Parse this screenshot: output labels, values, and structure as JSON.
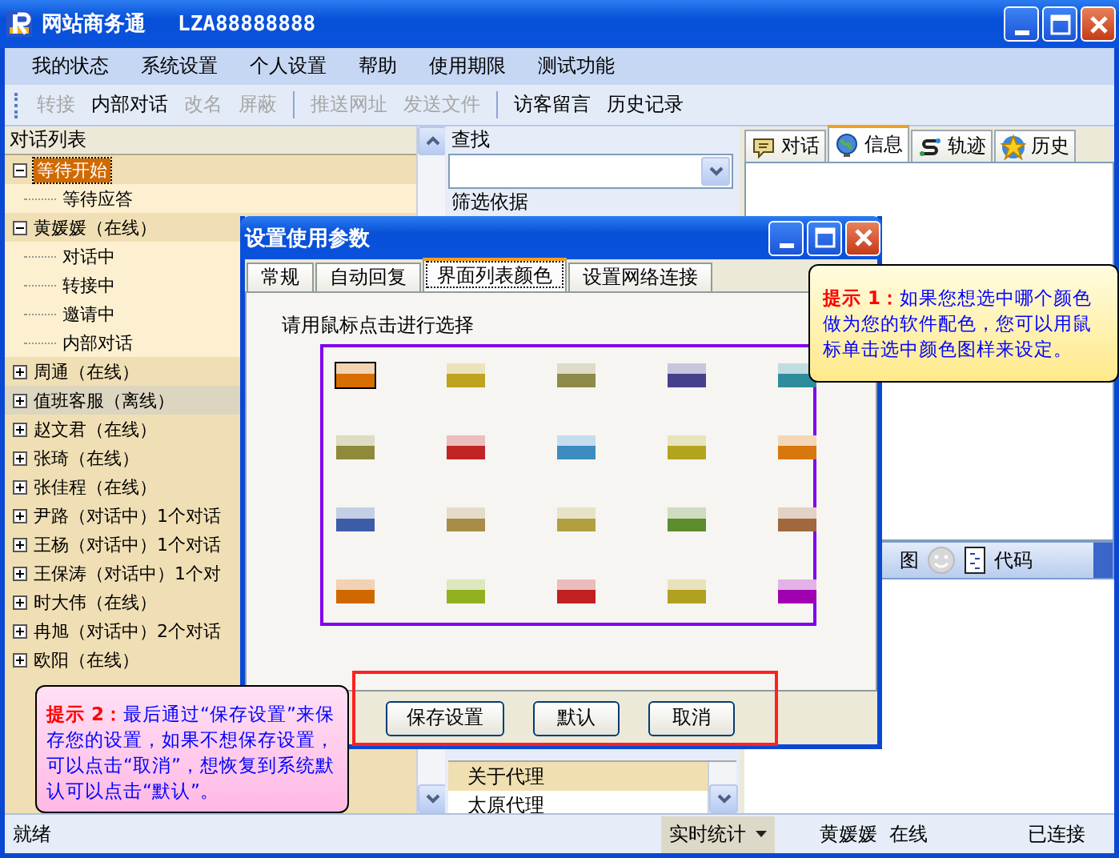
{
  "window": {
    "title": "网站商务通",
    "account": "LZA88888888"
  },
  "menu": [
    "我的状态",
    "系统设置",
    "个人设置",
    "帮助",
    "使用期限",
    "测试功能"
  ],
  "toolbar": [
    [
      {
        "label": "转接",
        "disabled": true
      },
      {
        "label": "内部对话",
        "disabled": false
      },
      {
        "label": "改名",
        "disabled": true
      },
      {
        "label": "屏蔽",
        "disabled": true
      }
    ],
    [
      {
        "label": "推送网址",
        "disabled": true
      },
      {
        "label": "发送文件",
        "disabled": true
      }
    ],
    [
      {
        "label": "访客留言",
        "disabled": false
      },
      {
        "label": "历史记录",
        "disabled": false
      }
    ]
  ],
  "chat_list": {
    "header": "对话列表",
    "items": [
      {
        "label": "等待开始",
        "expanded": true,
        "selected": true,
        "offline": false,
        "children": [
          {
            "label": "等待应答"
          }
        ]
      },
      {
        "label": "黄媛媛（在线）",
        "expanded": true,
        "selected": false,
        "offline": false,
        "children": [
          {
            "label": "对话中"
          },
          {
            "label": "转接中"
          },
          {
            "label": "邀请中"
          },
          {
            "label": "内部对话"
          }
        ]
      },
      {
        "label": "周通（在线）",
        "expanded": false,
        "selected": false,
        "offline": false
      },
      {
        "label": "值班客服（离线）",
        "expanded": false,
        "selected": false,
        "offline": true
      },
      {
        "label": "赵文君（在线）",
        "expanded": false,
        "selected": false,
        "offline": false
      },
      {
        "label": "张琦（在线）",
        "expanded": false,
        "selected": false,
        "offline": false
      },
      {
        "label": "张佳程（在线）",
        "expanded": false,
        "selected": false,
        "offline": false
      },
      {
        "label": "尹路（对话中）1个对话",
        "expanded": false,
        "selected": false,
        "offline": false
      },
      {
        "label": "王杨（对话中）1个对话",
        "expanded": false,
        "selected": false,
        "offline": false
      },
      {
        "label": "王保涛（对话中）1个对",
        "expanded": false,
        "selected": false,
        "offline": false
      },
      {
        "label": "时大伟（在线）",
        "expanded": false,
        "selected": false,
        "offline": false
      },
      {
        "label": "冉旭（对话中）2个对话",
        "expanded": false,
        "selected": false,
        "offline": false
      },
      {
        "label": "欧阳（在线）",
        "expanded": false,
        "selected": false,
        "offline": false
      }
    ]
  },
  "search": {
    "label": "查找",
    "filter_label": "筛选依据"
  },
  "topic_list": [
    {
      "label": "关于代理",
      "selected": true
    },
    {
      "label": "太原代理",
      "selected": false
    }
  ],
  "info_tabs": [
    {
      "label": "对话",
      "kind": "chat",
      "selected": false
    },
    {
      "label": "信息",
      "kind": "globe",
      "selected": true
    },
    {
      "label": "轨迹",
      "kind": "track",
      "selected": false
    },
    {
      "label": "历史",
      "kind": "star",
      "selected": false
    }
  ],
  "input_toolbar": [
    {
      "label": "图",
      "kind": "text"
    },
    {
      "kind": "smiley"
    },
    {
      "label": "代码",
      "kind": "doc"
    }
  ],
  "status_bar": {
    "state": "就绪",
    "stats": "实时统计",
    "user": "黄媛媛  在线",
    "connection": "已连接"
  },
  "dialog": {
    "title": "设置使用参数",
    "tabs": [
      {
        "label": "常规",
        "selected": false
      },
      {
        "label": "自动回复",
        "selected": false
      },
      {
        "label": "界面列表颜色",
        "selected": true
      },
      {
        "label": "设置网络连接",
        "selected": false
      }
    ],
    "prompt": "请用鼠标点击进行选择",
    "swatches": [
      {
        "color": "#d66e00",
        "selected": true
      },
      {
        "color": "#bfa21e",
        "selected": false
      },
      {
        "color": "#8e8a48",
        "selected": false
      },
      {
        "color": "#463f8e",
        "selected": false
      },
      {
        "color": "#2f8c9c",
        "selected": false
      },
      {
        "color": "#8e8a3a",
        "selected": false
      },
      {
        "color": "#c02424",
        "selected": false
      },
      {
        "color": "#3c8cc0",
        "selected": false
      },
      {
        "color": "#b2a41e",
        "selected": false
      },
      {
        "color": "#d6780e",
        "selected": false
      },
      {
        "color": "#3c5ca8",
        "selected": false
      },
      {
        "color": "#a88c48",
        "selected": false
      },
      {
        "color": "#b0a040",
        "selected": false
      },
      {
        "color": "#5c8c2c",
        "selected": false
      },
      {
        "color": "#a0683c",
        "selected": false
      },
      {
        "color": "#d06800",
        "selected": false
      },
      {
        "color": "#90b020",
        "selected": false
      },
      {
        "color": "#c02020",
        "selected": false
      },
      {
        "color": "#b0a020",
        "selected": false
      },
      {
        "color": "#a000b0",
        "selected": false
      }
    ],
    "buttons": [
      "保存设置",
      "默认",
      "取消"
    ]
  },
  "tips": [
    {
      "text": "**提示 1：**如果您想选中哪个颜色做为您的软件配色，您可以用鼠标单击选中颜色图样来设定。"
    },
    {
      "text": "**提示 2：**最后通过“保存设置”来保存您的设置，如果不想保存设置，可以点击“取消”，想恢复到系统默认可以点击“默认”。"
    }
  ]
}
